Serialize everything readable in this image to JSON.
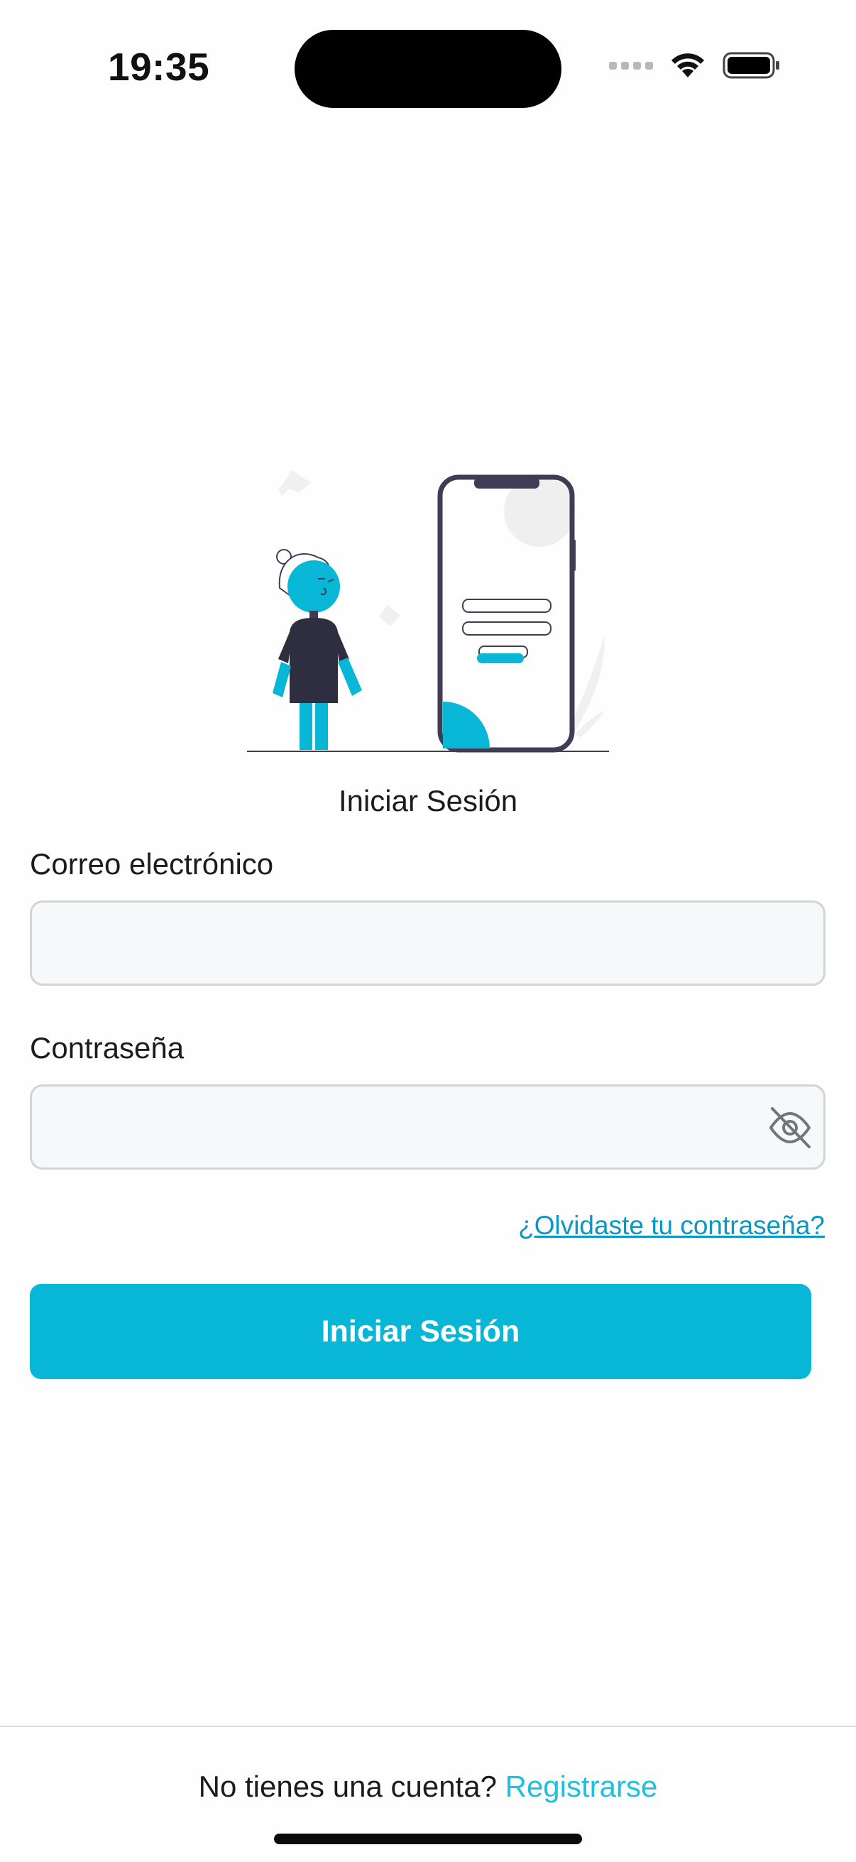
{
  "status_bar": {
    "time": "19:35"
  },
  "illustration": {
    "icon": "login-illustration"
  },
  "form": {
    "title": "Iniciar Sesión",
    "email_label": "Correo electrónico",
    "email_value": "",
    "password_label": "Contraseña",
    "password_value": "",
    "toggle_visibility_icon": "eye-off-icon",
    "forgot_password": "¿Olvidaste tu contraseña?",
    "submit_label": "Iniciar Sesión"
  },
  "footer": {
    "prompt": "No tienes una cuenta?",
    "register_link": "Registrarse"
  },
  "colors": {
    "accent": "#08b6d6",
    "link": "#1fc0de",
    "forgot_link": "#0a98c2",
    "dark": "#3f3d56"
  }
}
